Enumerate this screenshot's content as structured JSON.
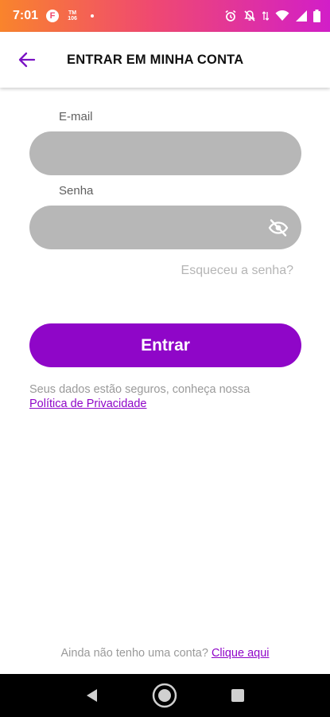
{
  "status_bar": {
    "time": "7:01",
    "notification_f": "F",
    "notification_tm_top": "TM",
    "notification_tm_bottom": "106"
  },
  "header": {
    "title": "ENTRAR EM MINHA CONTA",
    "back_icon": "arrow-left-icon"
  },
  "form": {
    "email_label": "E-mail",
    "email_value": "",
    "password_label": "Senha",
    "password_value": "",
    "password_toggle_icon": "eye-off-icon",
    "forgot_password": "Esqueceu a senha?",
    "submit_label": "Entrar"
  },
  "privacy": {
    "text": "Seus dados estão seguros, conheça nossa",
    "link": "Política de Privacidade"
  },
  "signup": {
    "text": "Ainda não tenho uma conta?",
    "link": "Clique aqui"
  },
  "colors": {
    "accent": "#8f06c8",
    "input_bg": "#b7b7b7",
    "status_gradient_start": "#f9842c",
    "status_gradient_end": "#d21ec8"
  }
}
